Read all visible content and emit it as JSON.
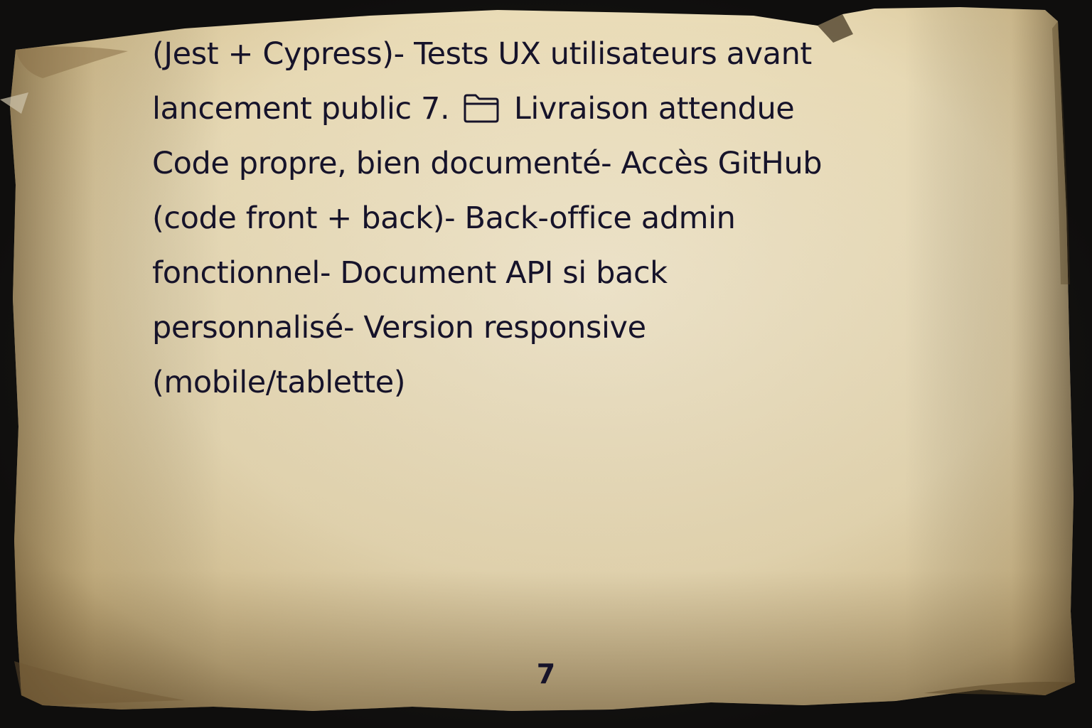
{
  "document": {
    "lines": [
      "(Jest + Cypress)- Tests UX utilisateurs avant",
      "lancement public 7.",
      "Livraison attendue",
      "Code propre, bien documenté- Accès GitHub",
      "(code front + back)- Back-office admin",
      "fonctionnel- Document API si back",
      "personnalisé- Version responsive",
      "(mobile/tablette)"
    ],
    "inline_icon": "folder-icon"
  },
  "footer": {
    "page_number": "7"
  },
  "colors": {
    "text": "#16132a",
    "parchment": "#eee1bf",
    "background": "#141414"
  }
}
